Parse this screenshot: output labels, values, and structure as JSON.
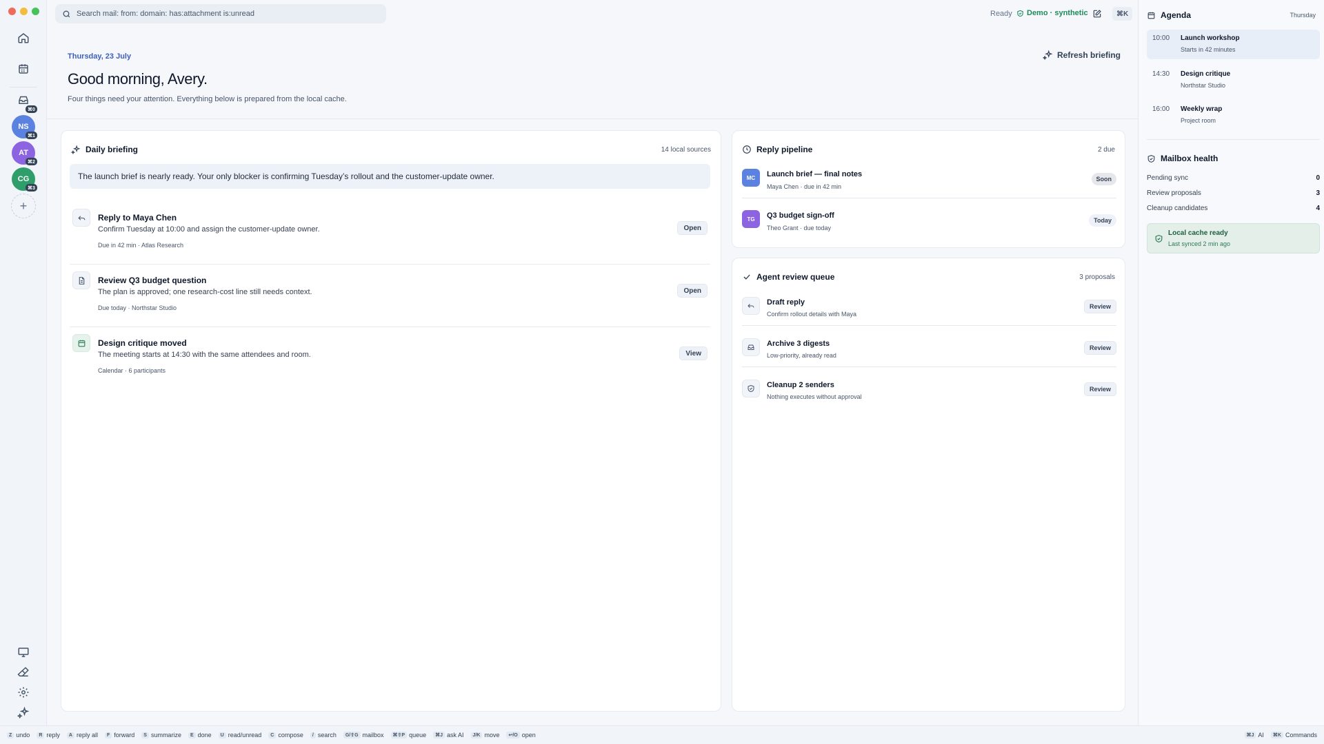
{
  "rail": {
    "accounts": [
      {
        "initials": "NS",
        "shortcut": "⌘1",
        "color": "#5b82e0"
      },
      {
        "initials": "AT",
        "shortcut": "⌘2",
        "color": "#8c63e0"
      },
      {
        "initials": "CG",
        "shortcut": "⌘3",
        "color": "#2f9e6a"
      }
    ],
    "inbox_shortcut": "⌘0",
    "add_label": "+"
  },
  "topbar": {
    "search_placeholder": "Search mail: from: domain: has:attachment is:unread",
    "status": "Ready",
    "workspace": "Demo · synthetic",
    "command_shortcut": "⌘K"
  },
  "hero": {
    "date": "Thursday, 23 July",
    "greeting": "Good morning, Avery.",
    "subtitle": "Four things need your attention. Everything below is prepared from the local cache.",
    "refresh_label": "Refresh briefing"
  },
  "briefing": {
    "title": "Daily briefing",
    "meta": "14 local sources",
    "summary": "The launch brief is nearly ready. Your only blocker is confirming Tuesday’s rollout and the customer-update owner.",
    "tasks": [
      {
        "title": "Reply to Maya Chen",
        "desc": "Confirm Tuesday at 10:00 and assign the customer-update owner.",
        "meta": "Due in 42 min · Atlas Research",
        "action": "Open",
        "icon": "reply-icon"
      },
      {
        "title": "Review Q3 budget question",
        "desc": "The plan is approved; one research-cost line still needs context.",
        "meta": "Due today · Northstar Studio",
        "action": "Open",
        "icon": "document-icon"
      },
      {
        "title": "Design critique moved",
        "desc": "The meeting starts at 14:30 with the same attendees and room.",
        "meta": "Calendar · 6 participants",
        "action": "View",
        "icon": "calendar-icon"
      }
    ]
  },
  "pipeline": {
    "title": "Reply pipeline",
    "meta": "2 due",
    "items": [
      {
        "initials": "MC",
        "title": "Launch brief — final notes",
        "sub": "Maya Chen · due in 42 min",
        "badge": "Soon",
        "color": "#5b82e0",
        "badge_bg": "#e5e7eb"
      },
      {
        "initials": "TG",
        "title": "Q3 budget sign-off",
        "sub": "Theo Grant · due today",
        "badge": "Today",
        "color": "#8c63e0",
        "badge_bg": "#eef2f8"
      }
    ]
  },
  "queue": {
    "title": "Agent review queue",
    "meta": "3 proposals",
    "items": [
      {
        "title": "Draft reply",
        "sub": "Confirm rollout details with Maya",
        "action": "Review",
        "icon": "reply-icon"
      },
      {
        "title": "Archive 3 digests",
        "sub": "Low-priority, already read",
        "action": "Review",
        "icon": "inbox-icon"
      },
      {
        "title": "Cleanup 2 senders",
        "sub": "Nothing executes without approval",
        "action": "Review",
        "icon": "shield-icon"
      }
    ]
  },
  "agenda": {
    "title": "Agenda",
    "day": "Thursday",
    "items": [
      {
        "time": "10:00",
        "title": "Launch workshop",
        "sub": "Starts in 42 minutes"
      },
      {
        "time": "14:30",
        "title": "Design critique",
        "sub": "Northstar Studio"
      },
      {
        "time": "16:00",
        "title": "Weekly wrap",
        "sub": "Project room"
      }
    ]
  },
  "health": {
    "title": "Mailbox health",
    "rows": [
      {
        "label": "Pending sync",
        "value": "0"
      },
      {
        "label": "Review proposals",
        "value": "3"
      },
      {
        "label": "Cleanup candidates",
        "value": "4"
      }
    ],
    "cache_title": "Local cache ready",
    "cache_sub": "Last synced 2 min ago"
  },
  "shortcuts": [
    {
      "key": "Z",
      "label": "undo"
    },
    {
      "key": "R",
      "label": "reply"
    },
    {
      "key": "A",
      "label": "reply all"
    },
    {
      "key": "F",
      "label": "forward"
    },
    {
      "key": "S",
      "label": "summarize"
    },
    {
      "key": "E",
      "label": "done"
    },
    {
      "key": "U",
      "label": "read/unread"
    },
    {
      "key": "C",
      "label": "compose"
    },
    {
      "key": "/",
      "label": "search"
    },
    {
      "key": "G/⇧G",
      "label": "mailbox"
    },
    {
      "key": "⌘⇧P",
      "label": "queue"
    },
    {
      "key": "⌘J",
      "label": "ask AI"
    },
    {
      "key": "J/K",
      "label": "move"
    },
    {
      "key": "↩/O",
      "label": "open"
    }
  ],
  "shortcuts_right": [
    {
      "key": "⌘J",
      "label": "AI"
    },
    {
      "key": "⌘K",
      "label": "Commands"
    }
  ]
}
